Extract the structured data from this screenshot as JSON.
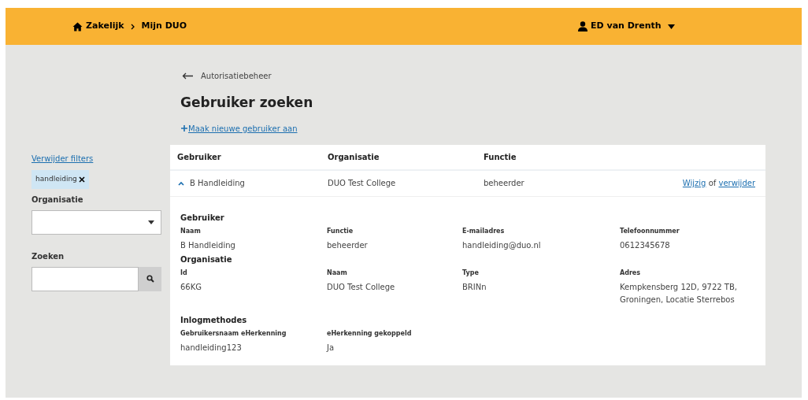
{
  "header": {
    "breadcrumbs": [
      "Zakelijk",
      "Mijn DUO"
    ],
    "user": "ED van Drenth"
  },
  "back_link": "Autorisatiebeheer",
  "title": "Gebruiker zoeken",
  "new_user_link": "Maak nieuwe gebruiker aan",
  "sidebar": {
    "clear_filters": "Verwijder filters",
    "active_filters": [
      "handleiding"
    ],
    "organisation_label": "Organisatie",
    "search_label": "Zoeken"
  },
  "table": {
    "columns": [
      "Gebruiker",
      "Organisatie",
      "Functie"
    ],
    "rows": [
      {
        "user": "B Handleiding",
        "organisation": "DUO Test College",
        "function": "beheerder",
        "edit_link": "Wijzig",
        "separator": "of",
        "delete_link": "verwijder",
        "expanded": true,
        "sections": [
          {
            "title": "Gebruiker",
            "fields": [
              {
                "label": "Naam",
                "value": "B Handleiding"
              },
              {
                "label": "Functie",
                "value": "beheerder"
              },
              {
                "label": "E-mailadres",
                "value": "handleiding@duo.nl"
              },
              {
                "label": "Telefoonnummer",
                "value": "0612345678"
              }
            ]
          },
          {
            "title": "Organisatie",
            "fields": [
              {
                "label": "Id",
                "value": "66KG"
              },
              {
                "label": "Naam",
                "value": "DUO Test College"
              },
              {
                "label": "Type",
                "value": "BRINn"
              },
              {
                "label": "Adres",
                "value": "Kempkensberg 12D, 9722 TB, Groningen, Locatie Sterrebos"
              }
            ]
          },
          {
            "title": "Inlogmethodes",
            "fields": [
              {
                "label": "Gebruikersnaam eHerkenning",
                "value": "handleiding123"
              },
              {
                "label": "eHerkenning gekoppeld",
                "value": "Ja"
              }
            ]
          }
        ]
      }
    ]
  }
}
